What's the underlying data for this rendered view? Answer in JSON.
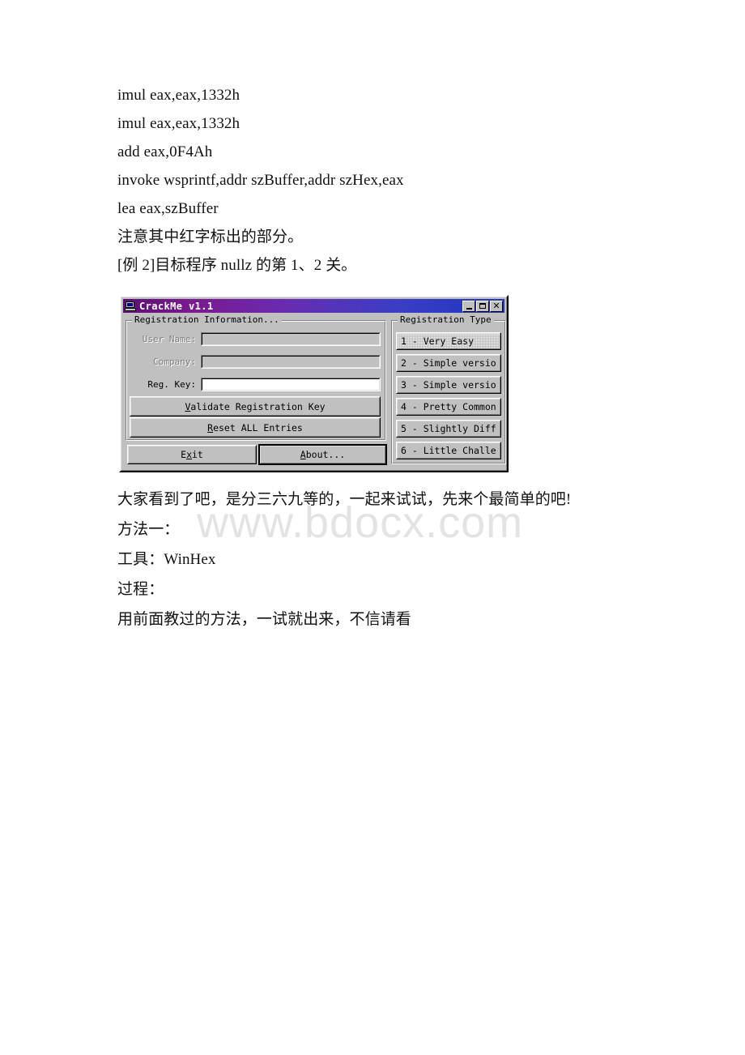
{
  "document": {
    "lines_before": [
      "imul eax,eax,1332h",
      "imul eax,eax,1332h",
      "add eax,0F4Ah",
      "invoke wsprintf,addr szBuffer,addr szHex,eax",
      "lea eax,szBuffer",
      "注意其中红字标出的部分。",
      "[例 2]目标程序 nullz 的第 1、2 关。"
    ],
    "lines_after": [
      "大家看到了吧，是分三六九等的，一起来试试，先来个最简单的吧!",
      "方法一：",
      "工具：WinHex",
      "过程：",
      "用前面教过的方法，一试就出来，不信请看"
    ]
  },
  "watermark": {
    "text": "www.bdocx.com",
    "color": "#e3e3e3"
  },
  "dialog": {
    "title": "CrackMe v1.1",
    "icon": "computer-icon",
    "titlebar_gradient_start": "#5a0f73",
    "titlebar_gradient_end": "#1f35c0",
    "face_color": "#c0c0c0",
    "window_buttons": {
      "minimize": "–",
      "maximize": "□",
      "close": "✕"
    },
    "registration_information": {
      "group_title": "Registration Information...",
      "fields": [
        {
          "label": "User Name:",
          "value": "",
          "disabled": true
        },
        {
          "label": "Company:",
          "value": "",
          "disabled": true
        },
        {
          "label": "Reg. Key:",
          "value": "",
          "disabled": false
        }
      ],
      "buttons": [
        {
          "prefix": "",
          "accel": "V",
          "suffix": "alidate Registration Key"
        },
        {
          "prefix": "",
          "accel": "R",
          "suffix": "eset ALL Entries"
        }
      ]
    },
    "registration_type": {
      "group_title": "Registration Type",
      "items": [
        {
          "label": "1 - Very Easy",
          "selected": true
        },
        {
          "label": "2 - Simple versio",
          "selected": false
        },
        {
          "label": "3 - Simple versio",
          "selected": false
        },
        {
          "label": "4 - Pretty Common",
          "selected": false
        },
        {
          "label": "5 - Slightly Diff",
          "selected": false
        },
        {
          "label": "6 - Little Challe",
          "selected": false
        }
      ]
    },
    "footer_buttons": [
      {
        "prefix": "E",
        "accel": "x",
        "suffix": "it",
        "default": false
      },
      {
        "prefix": "",
        "accel": "A",
        "suffix": "bout...",
        "default": true
      }
    ]
  }
}
